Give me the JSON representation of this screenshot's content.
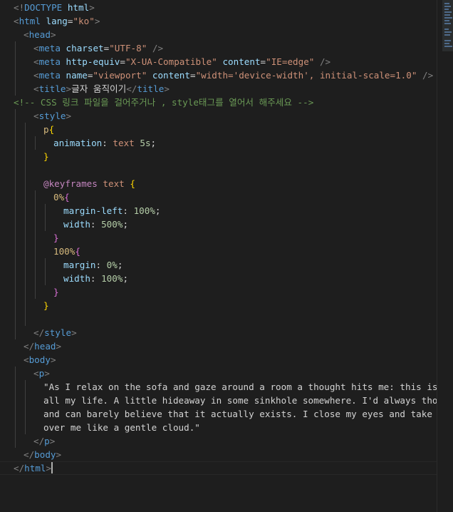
{
  "editor": {
    "language": "html",
    "colors": {
      "background": "#1e1e1e",
      "tag": "#569cd6",
      "bracket": "#808080",
      "attribute": "#9cdcfe",
      "string": "#ce9178",
      "comment": "#6a9955",
      "text": "#d4d4d4",
      "selector": "#d7ba7d",
      "property": "#9cdcfe",
      "value": "#ce9178",
      "number": "#b5cea8",
      "atrule": "#c586c0",
      "brace_yellow": "#ffd700",
      "brace_pink": "#da70d6"
    },
    "lines": [
      {
        "indent": 0,
        "tokens": [
          [
            "bk",
            "<!"
          ],
          [
            "tg",
            "DOCTYPE"
          ],
          [
            "tx",
            " "
          ],
          [
            "at",
            "html"
          ],
          [
            "bk",
            ">"
          ]
        ]
      },
      {
        "indent": 0,
        "tokens": [
          [
            "bk",
            "<"
          ],
          [
            "tg",
            "html"
          ],
          [
            "tx",
            " "
          ],
          [
            "at",
            "lang"
          ],
          [
            "tx",
            "="
          ],
          [
            "st",
            "\"ko\""
          ],
          [
            "bk",
            ">"
          ]
        ]
      },
      {
        "indent": 2,
        "tokens": [
          [
            "bk",
            "<"
          ],
          [
            "tg",
            "head"
          ],
          [
            "bk",
            ">"
          ]
        ]
      },
      {
        "indent": 4,
        "tokens": [
          [
            "bk",
            "<"
          ],
          [
            "tg",
            "meta"
          ],
          [
            "tx",
            " "
          ],
          [
            "at",
            "charset"
          ],
          [
            "tx",
            "="
          ],
          [
            "st",
            "\"UTF-8\""
          ],
          [
            "tx",
            " "
          ],
          [
            "bk",
            "/>"
          ]
        ]
      },
      {
        "indent": 4,
        "tokens": [
          [
            "bk",
            "<"
          ],
          [
            "tg",
            "meta"
          ],
          [
            "tx",
            " "
          ],
          [
            "at",
            "http-equiv"
          ],
          [
            "tx",
            "="
          ],
          [
            "st",
            "\"X-UA-Compatible\""
          ],
          [
            "tx",
            " "
          ],
          [
            "at",
            "content"
          ],
          [
            "tx",
            "="
          ],
          [
            "st",
            "\"IE=edge\""
          ],
          [
            "tx",
            " "
          ],
          [
            "bk",
            "/>"
          ]
        ]
      },
      {
        "indent": 4,
        "tokens": [
          [
            "bk",
            "<"
          ],
          [
            "tg",
            "meta"
          ],
          [
            "tx",
            " "
          ],
          [
            "at",
            "name"
          ],
          [
            "tx",
            "="
          ],
          [
            "st",
            "\"viewport\""
          ],
          [
            "tx",
            " "
          ],
          [
            "at",
            "content"
          ],
          [
            "tx",
            "="
          ],
          [
            "st",
            "\"width='device-width', initial-scale=1.0\""
          ],
          [
            "tx",
            " "
          ],
          [
            "bk",
            "/>"
          ]
        ]
      },
      {
        "indent": 4,
        "tokens": [
          [
            "bk",
            "<"
          ],
          [
            "tg",
            "title"
          ],
          [
            "bk",
            ">"
          ],
          [
            "tx",
            "글자 움직이기"
          ],
          [
            "bk",
            "</"
          ],
          [
            "tg",
            "title"
          ],
          [
            "bk",
            ">"
          ]
        ]
      },
      {
        "indent": 0,
        "tokens": [
          [
            "cm",
            "<!-- CSS 링크 파일을 걸어주거나 , style태그를 열어서 해주세요 -->"
          ]
        ]
      },
      {
        "indent": 4,
        "tokens": [
          [
            "bk",
            "<"
          ],
          [
            "tg",
            "style"
          ],
          [
            "bk",
            ">"
          ]
        ]
      },
      {
        "indent": 6,
        "tokens": [
          [
            "sl",
            "p"
          ],
          [
            "by",
            "{"
          ]
        ]
      },
      {
        "indent": 8,
        "tokens": [
          [
            "pr",
            "animation"
          ],
          [
            "tx",
            ": "
          ],
          [
            "vl",
            "text"
          ],
          [
            "tx",
            " "
          ],
          [
            "nm",
            "5s"
          ],
          [
            "tx",
            ";"
          ]
        ]
      },
      {
        "indent": 6,
        "tokens": [
          [
            "by",
            "}"
          ]
        ]
      },
      {
        "indent": 0,
        "tokens": []
      },
      {
        "indent": 6,
        "tokens": [
          [
            "ar",
            "@keyframes"
          ],
          [
            "tx",
            " "
          ],
          [
            "vl",
            "text"
          ],
          [
            "tx",
            " "
          ],
          [
            "by",
            "{"
          ]
        ]
      },
      {
        "indent": 8,
        "tokens": [
          [
            "sl",
            "0%"
          ],
          [
            "bp",
            "{"
          ]
        ]
      },
      {
        "indent": 10,
        "tokens": [
          [
            "pr",
            "margin-left"
          ],
          [
            "tx",
            ": "
          ],
          [
            "nm",
            "100%"
          ],
          [
            "tx",
            ";"
          ]
        ]
      },
      {
        "indent": 10,
        "tokens": [
          [
            "pr",
            "width"
          ],
          [
            "tx",
            ": "
          ],
          [
            "nm",
            "500%"
          ],
          [
            "tx",
            ";"
          ]
        ]
      },
      {
        "indent": 8,
        "tokens": [
          [
            "bp",
            "}"
          ]
        ]
      },
      {
        "indent": 8,
        "tokens": [
          [
            "sl",
            "100%"
          ],
          [
            "bp",
            "{"
          ]
        ]
      },
      {
        "indent": 10,
        "tokens": [
          [
            "pr",
            "margin"
          ],
          [
            "tx",
            ": "
          ],
          [
            "nm",
            "0%"
          ],
          [
            "tx",
            ";"
          ]
        ]
      },
      {
        "indent": 10,
        "tokens": [
          [
            "pr",
            "width"
          ],
          [
            "tx",
            ": "
          ],
          [
            "nm",
            "100%"
          ],
          [
            "tx",
            ";"
          ]
        ]
      },
      {
        "indent": 8,
        "tokens": [
          [
            "bp",
            "}"
          ]
        ]
      },
      {
        "indent": 6,
        "tokens": [
          [
            "by",
            "}"
          ]
        ]
      },
      {
        "indent": 0,
        "tokens": []
      },
      {
        "indent": 4,
        "tokens": [
          [
            "bk",
            "</"
          ],
          [
            "tg",
            "style"
          ],
          [
            "bk",
            ">"
          ]
        ]
      },
      {
        "indent": 2,
        "tokens": [
          [
            "bk",
            "</"
          ],
          [
            "tg",
            "head"
          ],
          [
            "bk",
            ">"
          ]
        ]
      },
      {
        "indent": 2,
        "tokens": [
          [
            "bk",
            "<"
          ],
          [
            "tg",
            "body"
          ],
          [
            "bk",
            ">"
          ]
        ]
      },
      {
        "indent": 4,
        "tokens": [
          [
            "bk",
            "<"
          ],
          [
            "tg",
            "p"
          ],
          [
            "bk",
            ">"
          ]
        ]
      },
      {
        "indent": 6,
        "tokens": [
          [
            "tx",
            "\"As I relax on the sofa and gaze around a room a thought hits me: this is exact"
          ]
        ]
      },
      {
        "indent": 6,
        "tokens": [
          [
            "tx",
            "all my life. A little hideaway in some sinkhole somewhere. I'd always thought o"
          ]
        ]
      },
      {
        "indent": 6,
        "tokens": [
          [
            "tx",
            "and can barely believe that it actually exists. I close my eyes and take a brea"
          ]
        ]
      },
      {
        "indent": 6,
        "tokens": [
          [
            "tx",
            "over me like a gentle cloud.\""
          ]
        ]
      },
      {
        "indent": 4,
        "tokens": [
          [
            "bk",
            "</"
          ],
          [
            "tg",
            "p"
          ],
          [
            "bk",
            ">"
          ]
        ]
      },
      {
        "indent": 2,
        "tokens": [
          [
            "bk",
            "</"
          ],
          [
            "tg",
            "body"
          ],
          [
            "bk",
            ">"
          ]
        ]
      },
      {
        "indent": 0,
        "tokens": [
          [
            "bk",
            "</"
          ],
          [
            "tg",
            "html"
          ],
          [
            "bk",
            ">"
          ]
        ]
      }
    ],
    "guides": [
      [],
      [],
      [],
      [
        1
      ],
      [
        1
      ],
      [
        1
      ],
      [
        1
      ],
      [],
      [
        1
      ],
      [
        1,
        2
      ],
      [
        1,
        2,
        3
      ],
      [
        1,
        2
      ],
      [
        1,
        2
      ],
      [
        1,
        2
      ],
      [
        1,
        2,
        3
      ],
      [
        1,
        2,
        3,
        4
      ],
      [
        1,
        2,
        3,
        4
      ],
      [
        1,
        2,
        3
      ],
      [
        1,
        2,
        3
      ],
      [
        1,
        2,
        3,
        4
      ],
      [
        1,
        2,
        3,
        4
      ],
      [
        1,
        2,
        3
      ],
      [
        1,
        2
      ],
      [
        1,
        2
      ],
      [
        1
      ],
      [],
      [],
      [
        1
      ],
      [
        1,
        2
      ],
      [
        1,
        2
      ],
      [
        1,
        2
      ],
      [
        1,
        2
      ],
      [
        1
      ],
      [],
      []
    ],
    "cursor_line": 34
  }
}
